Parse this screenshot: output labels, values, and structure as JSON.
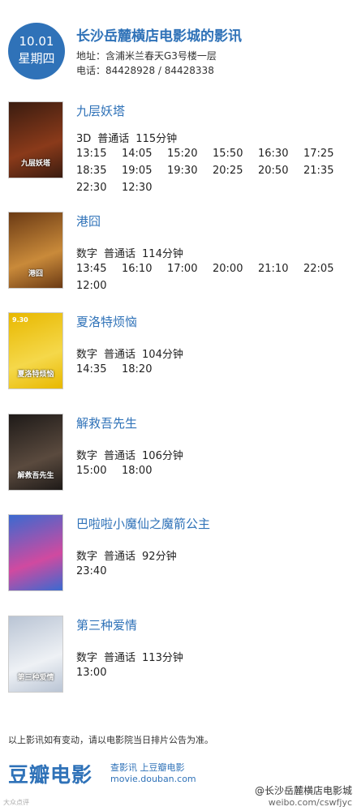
{
  "header": {
    "date": "10.01",
    "weekday": "星期四",
    "cinema": "长沙岳麓横店电影城的影讯",
    "address": "地址：含浦米兰春天G3号楼一层",
    "phone": "电话：84428928 / 84428338"
  },
  "movies": [
    {
      "title": "九层妖塔",
      "format": "3D",
      "language": "普通话",
      "duration": "115分钟",
      "poster_title": "九层妖塔",
      "poster_colors": [
        "#3a1c10",
        "#8a3a1a"
      ],
      "times": [
        "13:15",
        "14:05",
        "15:20",
        "15:50",
        "16:30",
        "17:25",
        "18:35",
        "19:05",
        "19:30",
        "20:25",
        "20:50",
        "21:35",
        "22:30",
        "12:30"
      ]
    },
    {
      "title": "港囧",
      "format": "数字",
      "language": "普通话",
      "duration": "114分钟",
      "poster_title": "港囧",
      "poster_colors": [
        "#6b3a14",
        "#c98a3a"
      ],
      "times": [
        "13:45",
        "16:10",
        "17:00",
        "20:00",
        "21:10",
        "22:05",
        "12:00"
      ]
    },
    {
      "title": "夏洛特烦恼",
      "format": "数字",
      "language": "普通话",
      "duration": "104分钟",
      "poster_title": "夏洛特烦恼",
      "poster_date": "9.30",
      "poster_colors": [
        "#e8b800",
        "#f5d84a"
      ],
      "times": [
        "14:35",
        "18:20"
      ]
    },
    {
      "title": "解救吾先生",
      "format": "数字",
      "language": "普通话",
      "duration": "106分钟",
      "poster_title": "解救吾先生",
      "poster_colors": [
        "#1e1a18",
        "#5a4a3e"
      ],
      "times": [
        "15:00",
        "18:00"
      ]
    },
    {
      "title": "巴啦啦小魔仙之魔箭公主",
      "format": "数字",
      "language": "普通话",
      "duration": "92分钟",
      "poster_title": "",
      "poster_colors": [
        "#3a6ad0",
        "#d04aa0"
      ],
      "times": [
        "23:40"
      ]
    },
    {
      "title": "第三种爱情",
      "format": "数字",
      "language": "普通话",
      "duration": "113分钟",
      "poster_title": "第三种爱情",
      "poster_colors": [
        "#b9c4d4",
        "#eef1f5"
      ],
      "times": [
        "13:00"
      ]
    }
  ],
  "footer": {
    "note": "以上影讯如有变动，请以电影院当日排片公告为准。",
    "logo": "豆瓣电影",
    "slogan": "查影讯  上豆瓣电影",
    "url": "movie.douban.com",
    "watermark_handle": "@长沙岳麓横店电影城",
    "watermark_url": "weibo.com/cswfjyc",
    "corner_mark": "大众点评"
  },
  "colors": {
    "accent": "#2f72b8"
  }
}
